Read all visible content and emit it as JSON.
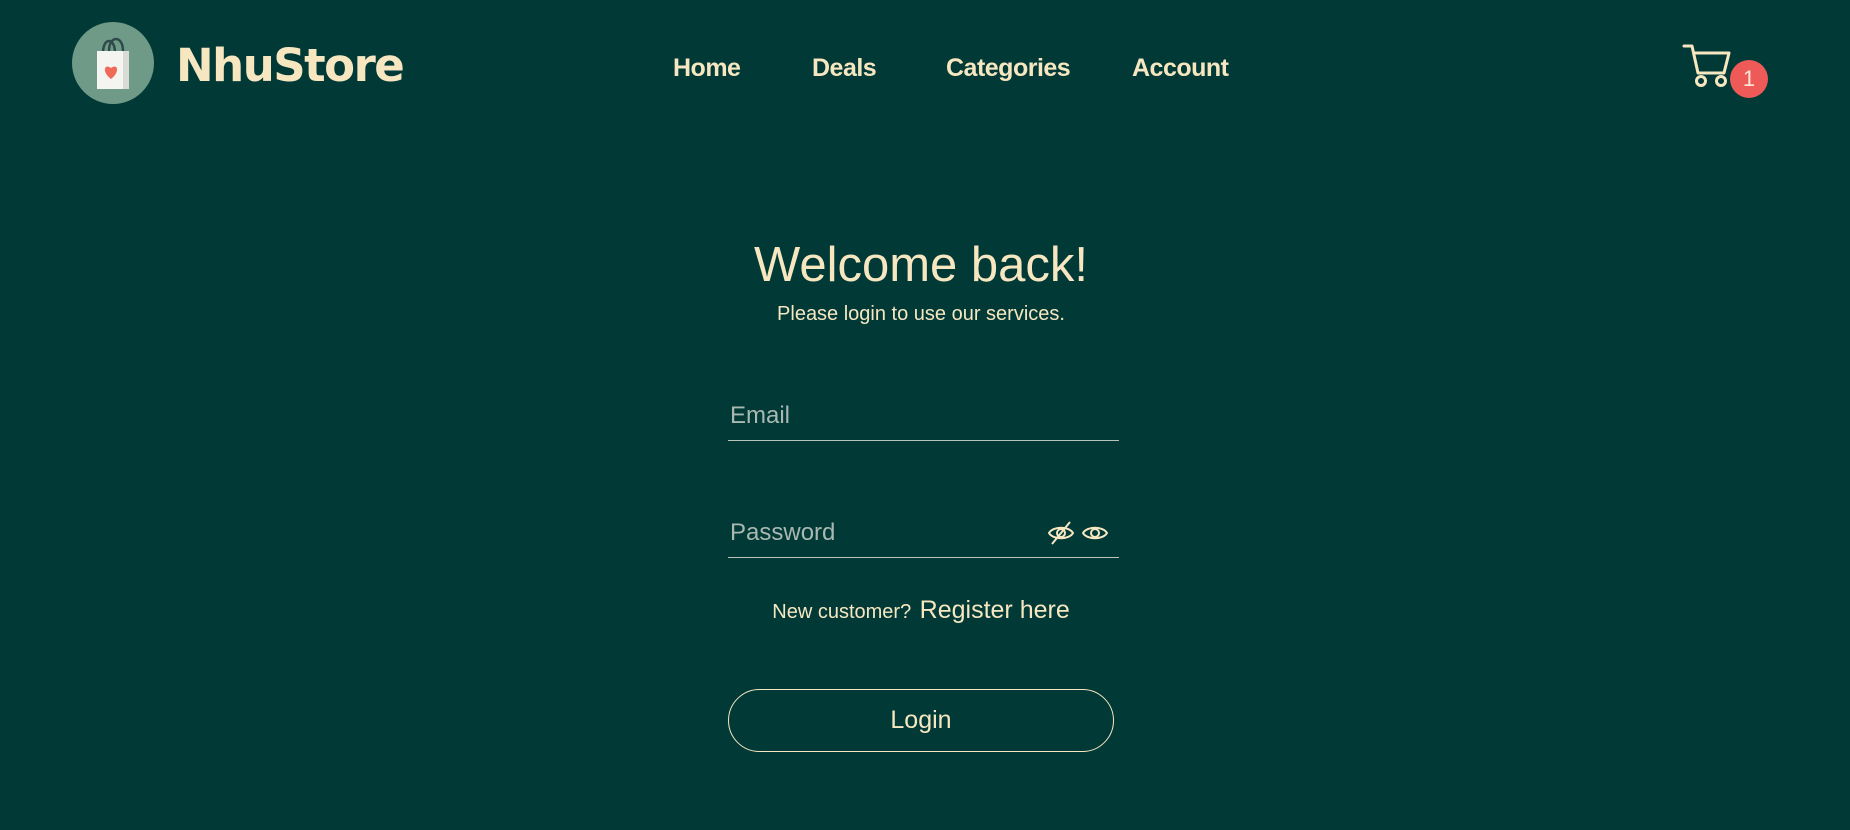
{
  "header": {
    "brand": "NhuStore",
    "logo_icon": "shopping-bag-heart-icon",
    "nav": {
      "home": "Home",
      "deals": "Deals",
      "categories": "Categories",
      "account": "Account"
    },
    "cart_icon": "cart-icon",
    "cart_count": "1"
  },
  "login": {
    "title": "Welcome back!",
    "subtitle": "Please login to use our services.",
    "email_placeholder": "Email",
    "password_placeholder": "Password",
    "register_prompt": "New customer?",
    "register_link": "Register here",
    "login_button": "Login"
  },
  "colors": {
    "background": "#003936",
    "text": "#f6e7c1",
    "logo_circle": "#6f9a87",
    "badge": "#ee5a57"
  }
}
